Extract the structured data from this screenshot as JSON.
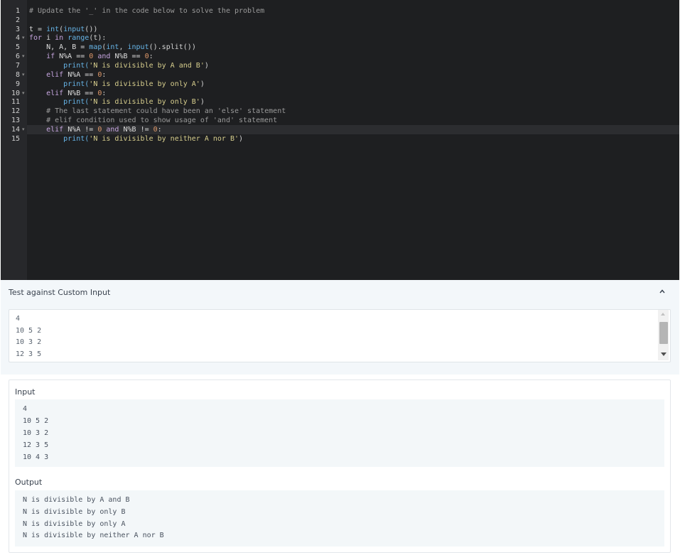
{
  "editor": {
    "line_numbers": [
      "1",
      "2",
      "3",
      "4",
      "5",
      "6",
      "7",
      "8",
      "9",
      "10",
      "11",
      "12",
      "13",
      "14",
      "15"
    ],
    "fold_lines": [
      "4",
      "6",
      "8",
      "10",
      "14"
    ],
    "code": {
      "l1_comment": "# Update the '_' in the code below to solve the problem",
      "l3_t": "t",
      "l3_eq": " = ",
      "l3_int": "int",
      "l3_p1": "(",
      "l3_input": "input",
      "l3_p2": "())",
      "l4_for": "for",
      "l4_i": " i ",
      "l4_in": "in",
      "l4_sp": " ",
      "l4_range": "range",
      "l4_arg": "(t):",
      "l5_vars": "    N, A, B = ",
      "l5_map": "map",
      "l5_p1": "(",
      "l5_int": "int",
      "l5_comma": ", ",
      "l5_input": "input",
      "l5_split": "().split",
      "l5_end": "())",
      "l6_if": "    if",
      "l6_cond1": " N%A == ",
      "l6_zero1": "0",
      "l6_and": " and",
      "l6_cond2": " N%B == ",
      "l6_zero2": "0",
      "l6_colon": ":",
      "l7_print": "        print(",
      "l7_str": "'N is divisible by A and B'",
      "l7_end": ")",
      "l8_elif": "    elif",
      "l8_cond": " N%A == ",
      "l8_zero": "0",
      "l8_colon": ":",
      "l9_print": "        print(",
      "l9_str": "'N is divisible by only A'",
      "l9_end": ")",
      "l10_elif": "    elif",
      "l10_cond": " N%B == ",
      "l10_zero": "0",
      "l10_colon": ":",
      "l11_print": "        print(",
      "l11_str": "'N is divisible by only B'",
      "l11_end": ")",
      "l12_comment": "    # The last statement could have been an 'else' statement",
      "l13_comment": "    # elif condition used to show usage of 'and' statement",
      "l14_elif": "    elif",
      "l14_cond1": " N%A != ",
      "l14_zero1": "0",
      "l14_and": " and",
      "l14_cond2": " N%B != ",
      "l14_zero2": "0",
      "l14_colon": ":",
      "l15_print": "        print(",
      "l15_str": "'N is divisible by neither A nor B'",
      "l15_end": ")"
    }
  },
  "custom_input": {
    "title": "Test against Custom Input",
    "lines": [
      "4",
      "10 5 2",
      "10 3 2",
      "12 3 5"
    ]
  },
  "result": {
    "input_label": "Input",
    "input_lines": [
      "4",
      "10 5 2",
      "10 3 2",
      "12 3 5",
      "10 4 3"
    ],
    "output_label": "Output",
    "output_lines": [
      "N is divisible by A and B",
      "N is divisible by only B",
      "N is divisible by only A",
      "N is divisible by neither A nor B"
    ]
  },
  "icons": {
    "collapse": "chevron-up-icon",
    "fold_marker": "fold-arrow-icon"
  },
  "colors": {
    "editor_bg": "#1e1f21",
    "keyword": "#c7a6e0",
    "function": "#67b5e8",
    "number": "#e0996a",
    "string": "#d7ce8d",
    "comment": "#9a9a9a"
  }
}
